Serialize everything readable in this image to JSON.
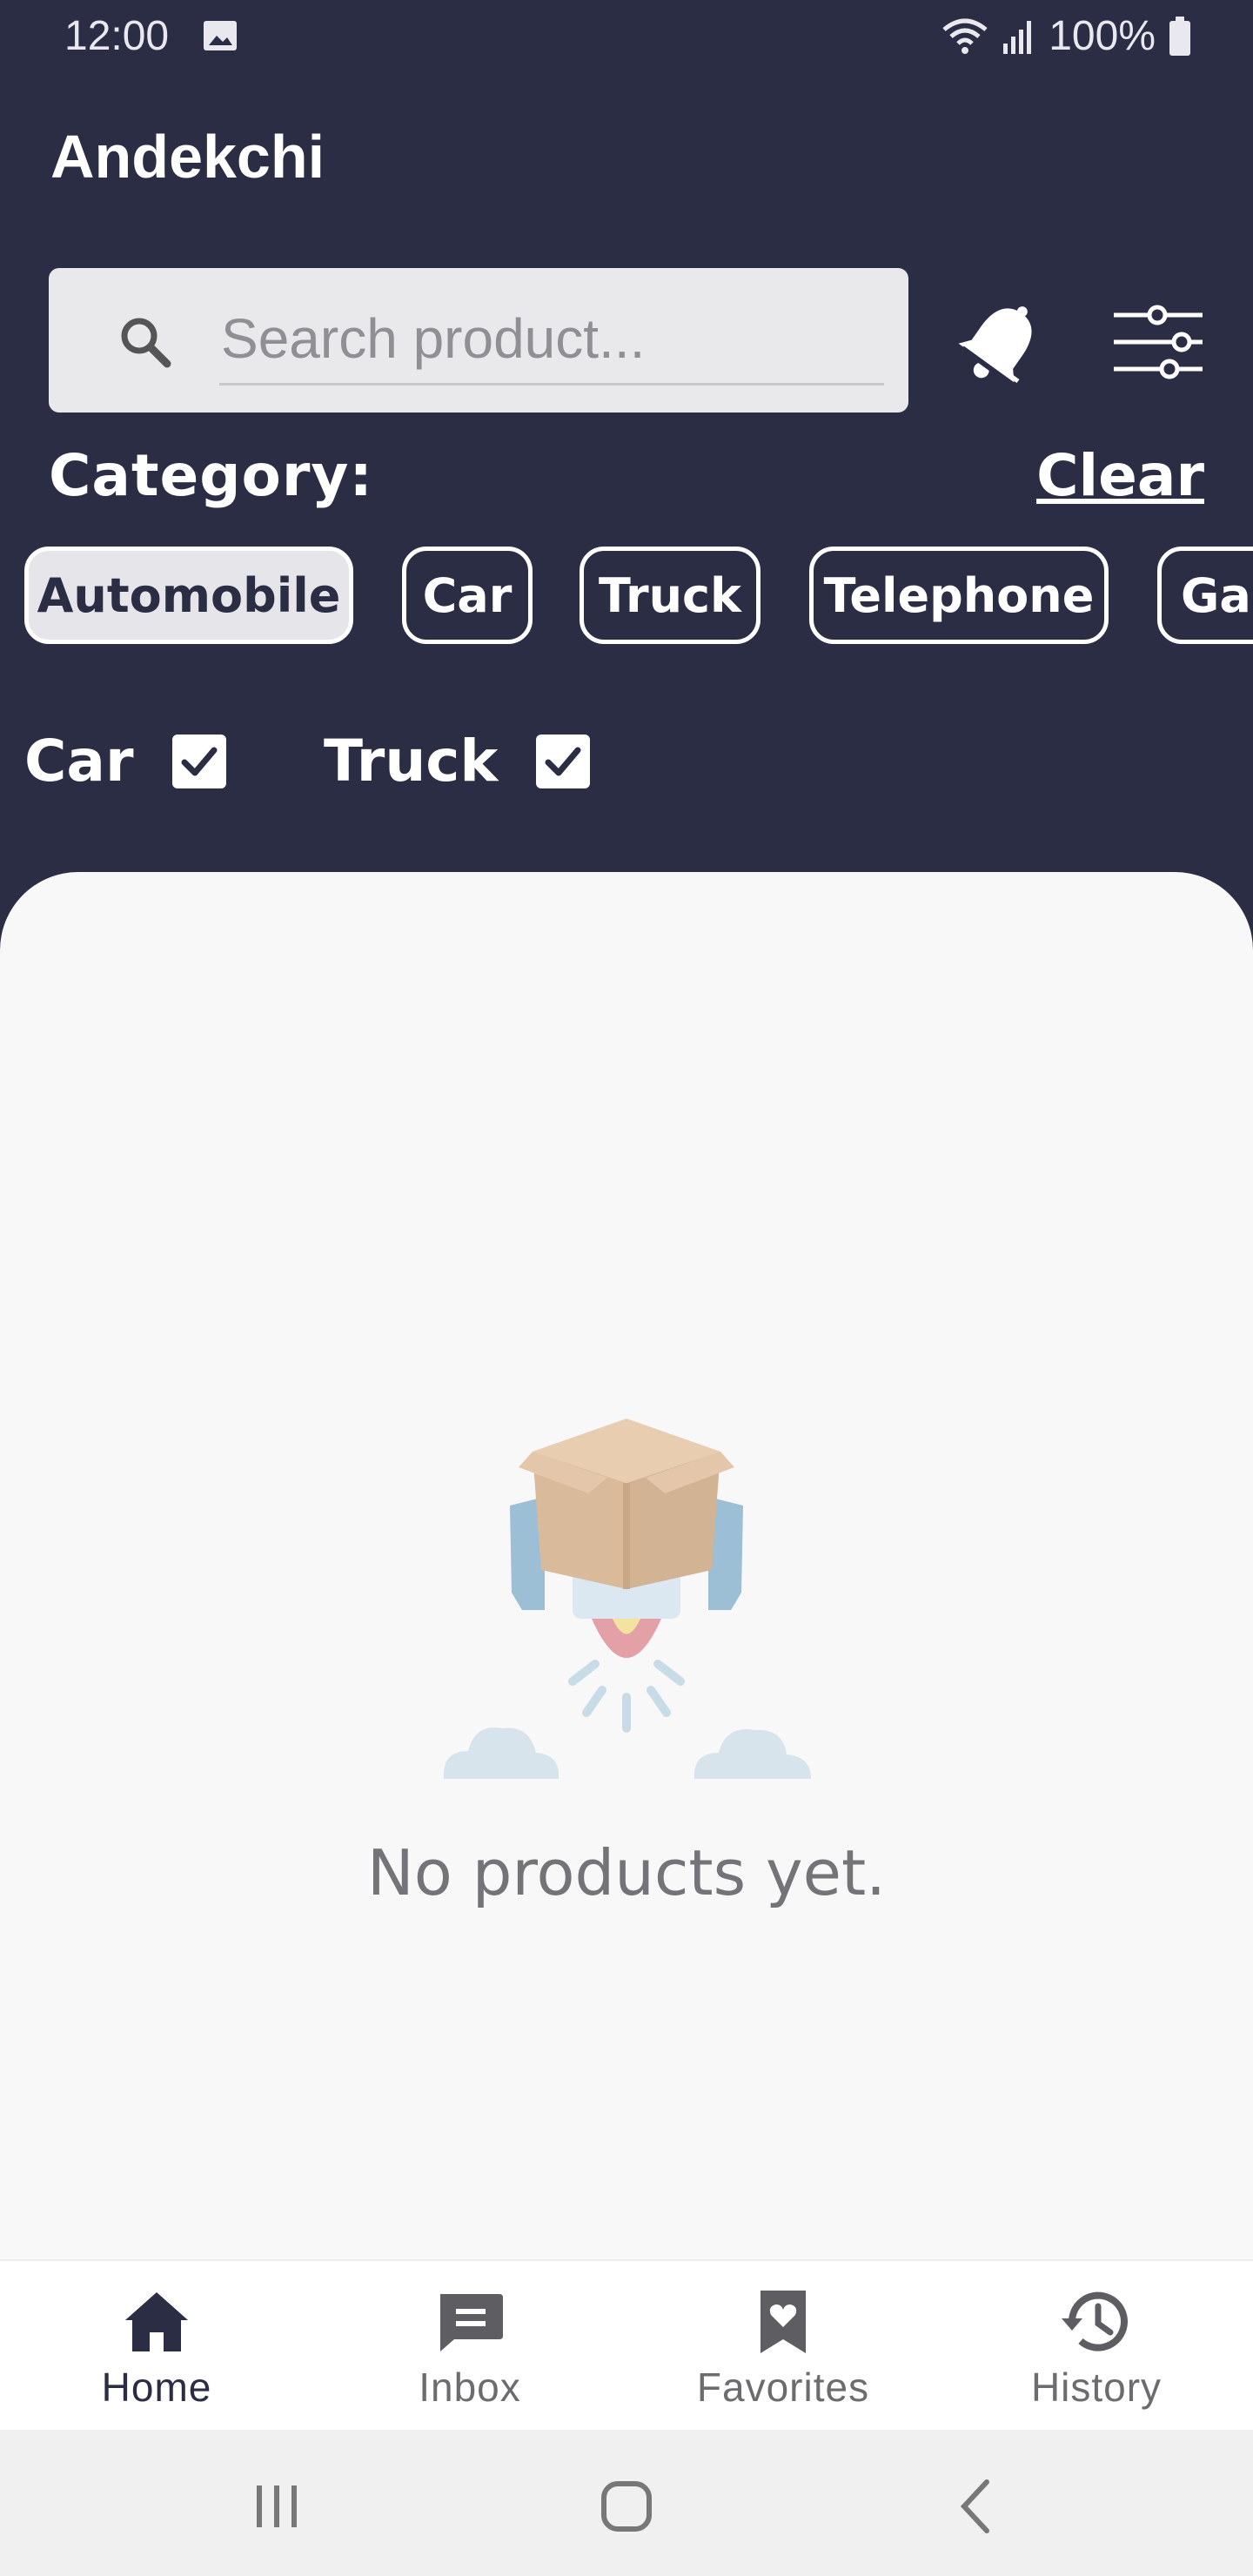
{
  "status_bar": {
    "time": "12:00",
    "battery": "100%"
  },
  "app": {
    "title": "Andekchi"
  },
  "search": {
    "placeholder": "Search product..."
  },
  "filters": {
    "category_label": "Category:",
    "clear_label": "Clear",
    "chips": [
      {
        "label": "Automobile",
        "selected": true
      },
      {
        "label": "Car",
        "selected": false
      },
      {
        "label": "Truck",
        "selected": false
      },
      {
        "label": "Telephone",
        "selected": false
      },
      {
        "label": "Gar",
        "selected": false
      }
    ],
    "checks": [
      {
        "label": "Car",
        "checked": true
      },
      {
        "label": "Truck",
        "checked": true
      }
    ]
  },
  "empty_state": {
    "message": "No products yet."
  },
  "bottom_nav": [
    {
      "label": "Home",
      "icon": "home-icon",
      "active": true
    },
    {
      "label": "Inbox",
      "icon": "chat-icon",
      "active": false
    },
    {
      "label": "Favorites",
      "icon": "favorites-icon",
      "active": false
    },
    {
      "label": "History",
      "icon": "history-icon",
      "active": false
    }
  ],
  "colors": {
    "header_bg": "#2b2d45",
    "panel_bg": "#f8f8f9",
    "active_nav": "#2b2d45"
  }
}
